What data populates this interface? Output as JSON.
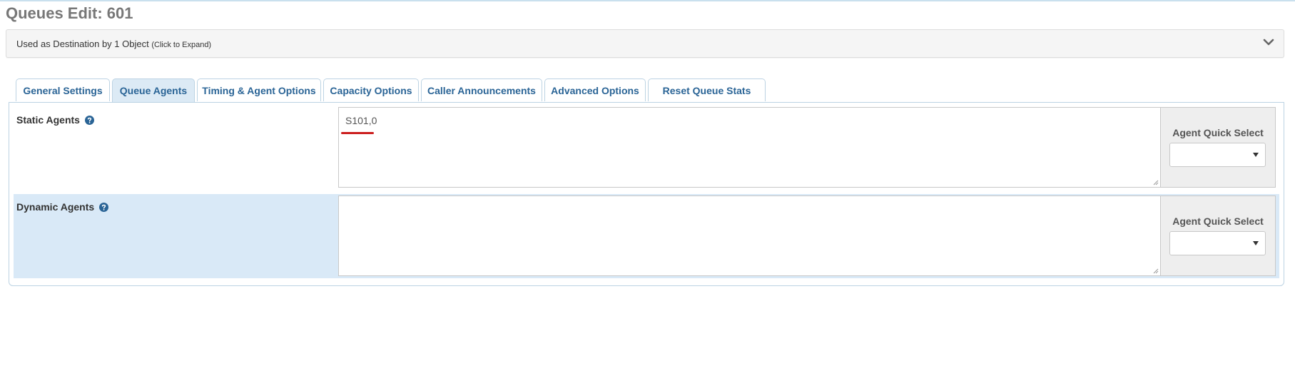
{
  "page": {
    "title": "Queues Edit: 601"
  },
  "destination_panel": {
    "text": "Used as Destination by 1 Object",
    "hint": "(Click to Expand)",
    "icon": "chevron-down-icon"
  },
  "tabs": [
    {
      "label": "General Settings",
      "active": false
    },
    {
      "label": "Queue Agents",
      "active": true
    },
    {
      "label": "Timing & Agent Options",
      "active": false
    },
    {
      "label": "Capacity Options",
      "active": false
    },
    {
      "label": "Caller Announcements",
      "active": false
    },
    {
      "label": "Advanced Options",
      "active": false
    },
    {
      "label": "Reset Queue Stats",
      "active": false
    }
  ],
  "static_agents": {
    "label": "Static Agents",
    "value": "S101,0",
    "quick_select_label": "Agent Quick Select",
    "quick_select_value": ""
  },
  "dynamic_agents": {
    "label": "Dynamic Agents",
    "value": "",
    "quick_select_label": "Agent Quick Select",
    "quick_select_value": ""
  },
  "colors": {
    "tab_text": "#2a6496",
    "active_tab_bg": "#dceaf5",
    "highlight_row_bg": "#d9e9f7",
    "annotation_underline": "#cc1f1f",
    "help_icon": "#2a6496"
  }
}
